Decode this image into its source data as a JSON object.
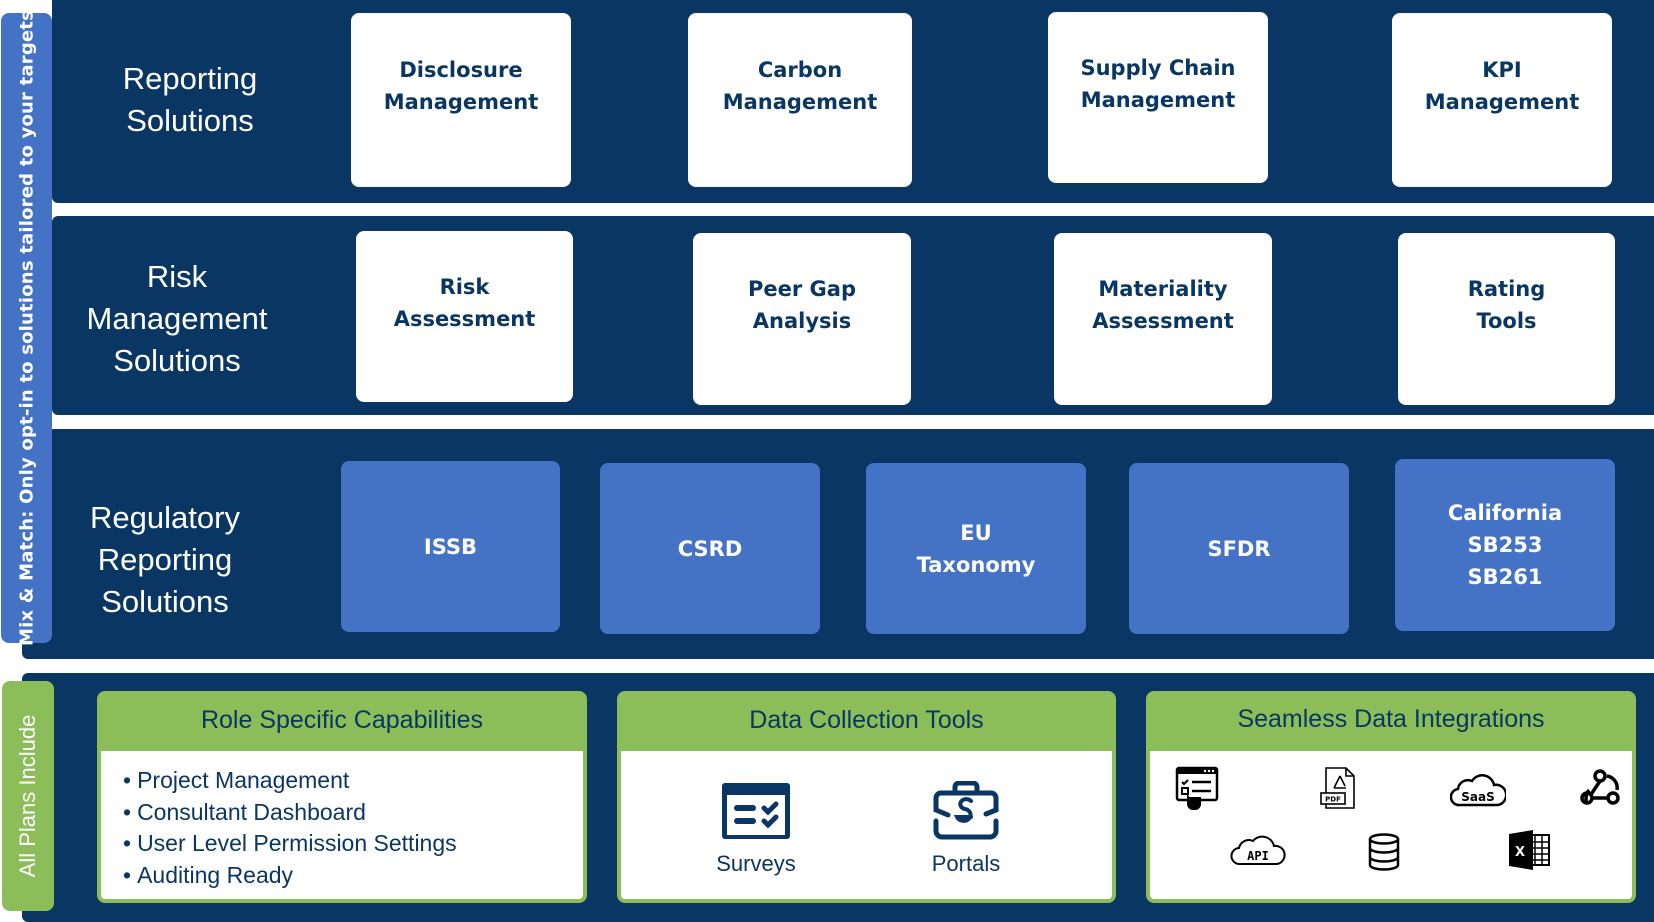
{
  "side_tabs": {
    "mix_match": "Mix & Match: Only opt-in to solutions tailored to your targets",
    "all_plans": "All Plans Include"
  },
  "rows": [
    {
      "label": "Reporting\nSolutions",
      "cards": [
        "Disclosure\nManagement",
        "Carbon\nManagement",
        "Supply Chain\nManagement",
        "KPI\nManagement"
      ]
    },
    {
      "label": "Risk\nManagement\nSolutions",
      "cards": [
        "Risk\nAssessment",
        "Peer Gap\nAnalysis",
        "Materiality\nAssessment",
        "Rating\nTools"
      ]
    },
    {
      "label": "Regulatory\nReporting\nSolutions",
      "cards": [
        "ISSB",
        "CSRD",
        "EU\nTaxonomy",
        "SFDR",
        "California\nSB253\nSB261"
      ]
    }
  ],
  "included": {
    "role_specific": {
      "title": "Role Specific Capabilities",
      "items": [
        "Project Management",
        "Consultant Dashboard",
        "User Level Permission Settings",
        "Auditing Ready"
      ]
    },
    "data_collection": {
      "title": "Data Collection Tools",
      "tools": [
        {
          "label": "Surveys",
          "icon": "survey-form-icon"
        },
        {
          "label": "Portals",
          "icon": "portal-briefcase-icon"
        }
      ]
    },
    "integrations": {
      "title": "Seamless Data Integrations",
      "icons": [
        "web-form-click-icon",
        "pdf-file-icon",
        "saas-cloud-icon",
        "webhook-icon",
        "api-cloud-icon",
        "database-icon",
        "excel-icon"
      ],
      "saas_text": "SaaS",
      "api_text": "API",
      "pdf_text": "PDF",
      "excel_text": "X"
    }
  },
  "colors": {
    "navy": "#0a3663",
    "blue": "#4472c4",
    "green": "#8bbd59",
    "white": "#ffffff"
  }
}
